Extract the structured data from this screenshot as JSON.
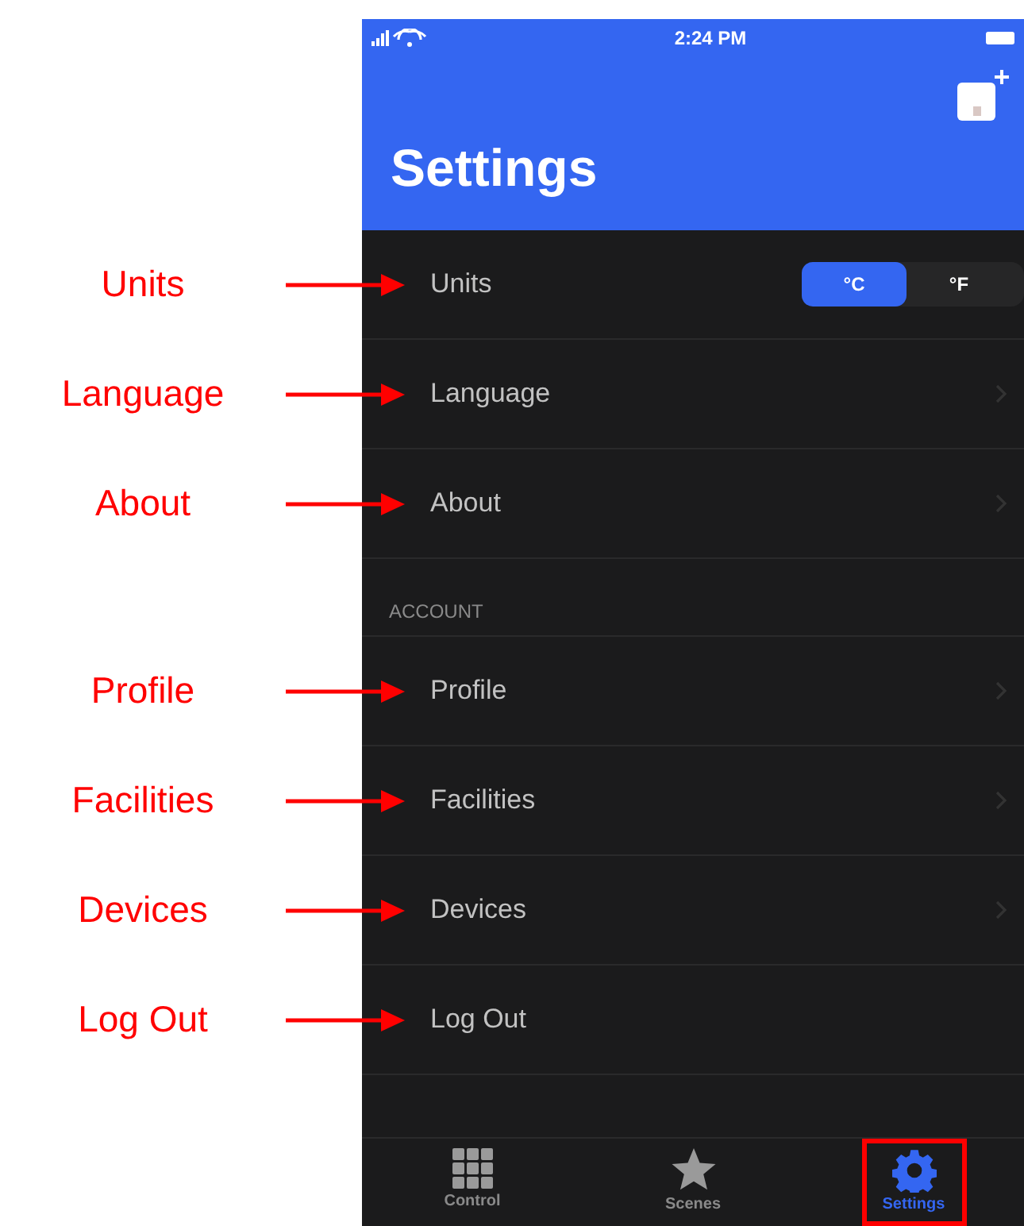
{
  "status_bar": {
    "time": "2:24 PM"
  },
  "header": {
    "title": "Settings"
  },
  "sections": [
    {
      "rows": [
        {
          "kind": "toggle",
          "label": "Units",
          "annotation": "Units",
          "options": [
            {
              "label": "°C",
              "selected": true
            },
            {
              "label": "°F",
              "selected": false
            }
          ]
        },
        {
          "kind": "link",
          "label": "Language",
          "annotation": "Language"
        },
        {
          "kind": "link",
          "label": "About",
          "annotation": "About"
        }
      ]
    },
    {
      "heading": "ACCOUNT",
      "rows": [
        {
          "kind": "link",
          "label": "Profile",
          "annotation": "Profile"
        },
        {
          "kind": "link",
          "label": "Facilities",
          "annotation": "Facilities"
        },
        {
          "kind": "link",
          "label": "Devices",
          "annotation": "Devices"
        },
        {
          "kind": "action",
          "label": "Log Out",
          "annotation": "Log Out"
        }
      ]
    }
  ],
  "tab_bar": [
    {
      "kind": "grid",
      "label": "Control",
      "selected": false,
      "highlighted": false
    },
    {
      "kind": "star",
      "label": "Scenes",
      "selected": false,
      "highlighted": false
    },
    {
      "kind": "gear",
      "label": "Settings",
      "selected": true,
      "highlighted": true
    }
  ]
}
